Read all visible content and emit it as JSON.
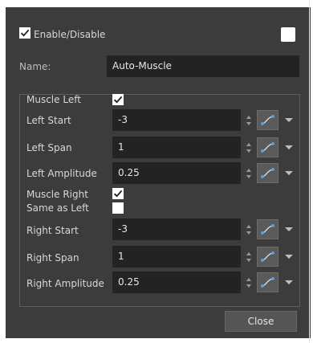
{
  "header": {
    "enable_label": "Enable/Disable",
    "enable_checked": true,
    "top_right_checked": false
  },
  "name_row": {
    "label": "Name:",
    "value": "Auto-Muscle"
  },
  "muscle_left": {
    "label": "Muscle Left",
    "checked": true
  },
  "rows_left": [
    {
      "label": "Left Start",
      "value": "-3"
    },
    {
      "label": "Left Span",
      "value": "1"
    },
    {
      "label": "Left Amplitude",
      "value": "0.25"
    }
  ],
  "muscle_right": {
    "label": "Muscle Right",
    "checked": true
  },
  "same_as_left": {
    "label": "Same as Left",
    "checked": false
  },
  "rows_right": [
    {
      "label": "Right Start",
      "value": "-3"
    },
    {
      "label": "Right Span",
      "value": "1"
    },
    {
      "label": "Right Amplitude",
      "value": "0.25"
    }
  ],
  "footer": {
    "close_label": "Close"
  },
  "icons": {
    "function_curve": "function-curve-icon",
    "spinner": "spinner-icon",
    "dropdown": "chevron-down-icon"
  },
  "colors": {
    "panel_bg": "#3c3c3c",
    "field_bg": "#232323",
    "button_bg": "#5a5a5a",
    "curve_accent": "#4aa3f0"
  }
}
